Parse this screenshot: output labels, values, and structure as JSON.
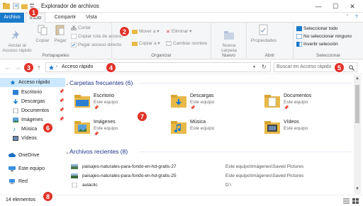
{
  "window": {
    "title": "Explorador de archivos",
    "minimize_glyph": "—",
    "maximize_glyph": "☐",
    "close_glyph": "✕",
    "help_glyph": "?",
    "ribbon_toggle_glyph": "ˆ"
  },
  "tabs": [
    "Archivo",
    "Inicio",
    "Compartir",
    "Vista"
  ],
  "ribbon": {
    "groups": {
      "portapapeles": "Portapapeles",
      "organizar": "Organizar",
      "nuevo": "Nuevo",
      "abrir": "Abrir",
      "seleccionar": "Seleccionar"
    },
    "pin_label": "Anclar al\nAcceso rápido",
    "copy_label": "Copiar",
    "paste_label": "Pegar",
    "cut_label": "Cortar",
    "copy_path_label": "Copiar ruta de acceso",
    "paste_shortcut_label": "Pegar acceso directo",
    "move_to_label": "Mover a",
    "copy_to_label": "Copiar a",
    "delete_label": "Eliminar",
    "rename_label": "Cambiar nombre",
    "new_folder_label": "Nueva\ncarpeta",
    "properties_label": "Propiedades",
    "select_all_label": "Seleccionar todo",
    "select_none_label": "No seleccionar ninguno",
    "invert_selection_label": "Invertir selección"
  },
  "address": {
    "path": "Acceso rápido",
    "search_placeholder": "Buscar en Acceso rápido"
  },
  "nav": {
    "items": [
      {
        "label": "Acceso rápido",
        "icon": "star-icon",
        "selected": true
      },
      {
        "label": "Escritorio",
        "icon": "desktop-icon",
        "pinned": true
      },
      {
        "label": "Descargas",
        "icon": "download-icon",
        "pinned": true
      },
      {
        "label": "Documentos",
        "icon": "documents-icon",
        "pinned": true
      },
      {
        "label": "Imágenes",
        "icon": "pictures-icon",
        "pinned": true
      },
      {
        "label": "Música",
        "icon": "music-icon"
      },
      {
        "label": "Vídeos",
        "icon": "videos-icon"
      },
      {
        "label": "OneDrive",
        "icon": "cloud-icon"
      },
      {
        "label": "Este equipo",
        "icon": "computer-icon"
      },
      {
        "label": "Red",
        "icon": "network-icon"
      }
    ]
  },
  "content": {
    "frequent_title": "Carpetas frecuentes (6)",
    "frequent": [
      {
        "name": "Escritorio",
        "location": "Este equipo",
        "icon": "desktop-folder-icon"
      },
      {
        "name": "Descargas",
        "location": "Este equipo",
        "icon": "download-folder-icon"
      },
      {
        "name": "Documentos",
        "location": "Este equipo",
        "icon": "documents-folder-icon"
      },
      {
        "name": "Imágenes",
        "location": "Este equipo",
        "icon": "pictures-folder-icon"
      },
      {
        "name": "Música",
        "location": "Este equipo",
        "icon": "music-folder-icon"
      },
      {
        "name": "Vídeos",
        "location": "Este equipo",
        "icon": "videos-folder-icon"
      }
    ],
    "recent_title": "Archivos recientes (8)",
    "recent": [
      {
        "name": "paisajes-naturales-para-fondo-en-hd-gratis-27",
        "path": "Este equipo\\Imágenes\\Saved Pictures"
      },
      {
        "name": "paisajes-naturales-para-fondo-en-hd-gratis-25",
        "path": "Este equipo\\Imágenes\\Saved Pictures"
      },
      {
        "name": "aulaclic",
        "path": "D:\\"
      }
    ]
  },
  "status": {
    "item_count": "14 elementos"
  },
  "markers": [
    "1",
    "2",
    "3",
    "4",
    "5",
    "6",
    "7",
    "8"
  ],
  "colors": {
    "accent": "#1979ca",
    "selection": "#cce8ff",
    "section_title": "#1e3287",
    "marker": "#e03228",
    "folder": "#e8b947"
  }
}
